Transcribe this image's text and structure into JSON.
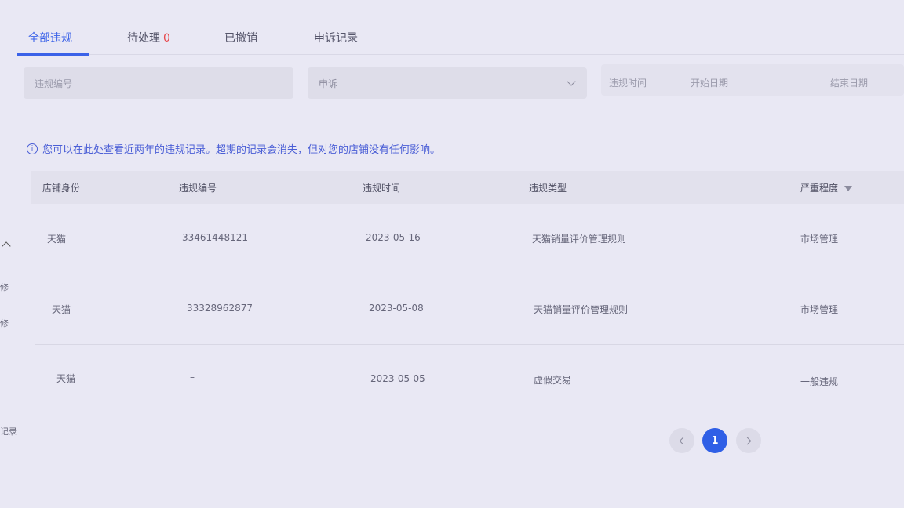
{
  "sidebar_fragments": [
    "修",
    "修",
    "记录"
  ],
  "tabs": [
    {
      "label": "全部违规",
      "count": ""
    },
    {
      "label": "待处理",
      "count": "0"
    },
    {
      "label": "已撤销",
      "count": ""
    },
    {
      "label": "申诉记录",
      "count": ""
    }
  ],
  "filters": {
    "violation_no_placeholder": "违规编号",
    "appeal_select_value": "申诉",
    "time_label": "违规时间",
    "start_date_placeholder": "开始日期",
    "date_separator": "-",
    "end_date_placeholder": "结束日期"
  },
  "notice": {
    "icon": "info-icon",
    "text": "您可以在此处查看近两年的违规记录。超期的记录会消失，但对您的店铺没有任何影响。"
  },
  "table": {
    "columns": [
      "店铺身份",
      "违规编号",
      "违规时间",
      "违规类型",
      "严重程度"
    ],
    "rows": [
      {
        "identity": "天猫",
        "violation_no": "33461448121",
        "time": "2023-05-16",
        "type": "天猫销量评价管理规则",
        "severity": "市场管理"
      },
      {
        "identity": "天猫",
        "violation_no": "33328962877",
        "time": "2023-05-08",
        "type": "天猫销量评价管理规则",
        "severity": "市场管理"
      },
      {
        "identity": "天猫",
        "violation_no": "–",
        "time": "2023-05-05",
        "type": "虚假交易",
        "severity": "一般违规"
      }
    ]
  },
  "pagination": {
    "current": "1"
  },
  "colors": {
    "accent": "#3b62e8",
    "count_red": "#e8474b",
    "notice_blue": "#4a5ed6"
  }
}
